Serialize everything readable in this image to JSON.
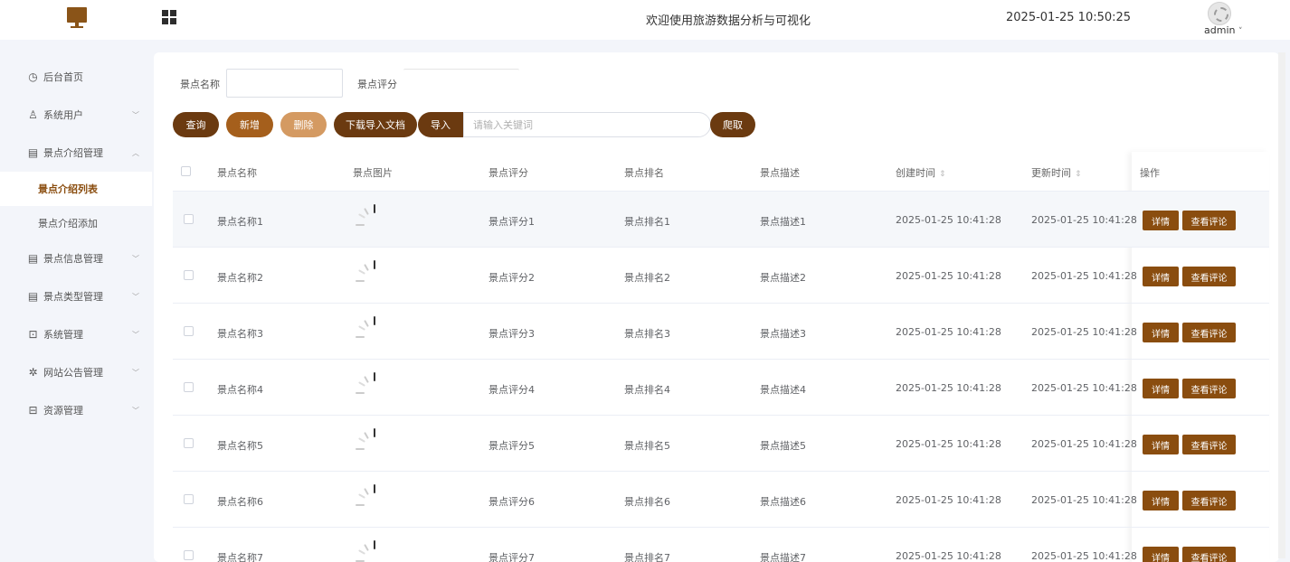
{
  "header": {
    "title": "欢迎使用旅游数据分析与可视化",
    "datetime": "2025-01-25 10:50:25",
    "username": "admin",
    "user_chevron": "˅"
  },
  "sidebar": {
    "items": [
      {
        "label": "后台首页",
        "icon": "clock-icon",
        "glyph": "◷"
      },
      {
        "label": "系统用户",
        "icon": "user-icon",
        "glyph": "♙",
        "chevron": "﹀"
      },
      {
        "label": "景点介绍管理",
        "icon": "doc-icon",
        "glyph": "▤",
        "chevron": "︿"
      },
      {
        "label": "景点信息管理",
        "icon": "doc-icon",
        "glyph": "▤",
        "chevron": "﹀"
      },
      {
        "label": "景点类型管理",
        "icon": "doc-icon",
        "glyph": "▤",
        "chevron": "﹀"
      },
      {
        "label": "系统管理",
        "icon": "folder-icon",
        "glyph": "⊡",
        "chevron": "﹀"
      },
      {
        "label": "网站公告管理",
        "icon": "sparkle-icon",
        "glyph": "✲",
        "chevron": "﹀"
      },
      {
        "label": "资源管理",
        "icon": "monitor-icon",
        "glyph": "⊟",
        "chevron": "﹀"
      }
    ],
    "subitems": [
      {
        "label": "景点介绍列表",
        "active": true
      },
      {
        "label": "景点介绍添加",
        "active": false
      }
    ]
  },
  "search": {
    "name_label": "景点名称",
    "name_value": "",
    "score_label": "景点评分",
    "score_value": ""
  },
  "toolbar": {
    "query": "查询",
    "add": "新增",
    "delete": "删除",
    "download_template": "下载导入文档",
    "import": "导入",
    "keyword_placeholder": "请输入关键词",
    "crawl": "爬取"
  },
  "table": {
    "columns": [
      "景点名称",
      "景点图片",
      "景点评分",
      "景点排名",
      "景点描述",
      "创建时间",
      "更新时间",
      "操作"
    ],
    "sort_glyph": "⇕",
    "detail_label": "详情",
    "comments_label": "查看评论",
    "rows": [
      {
        "name": "景点名称1",
        "score": "景点评分1",
        "rank": "景点排名1",
        "desc": "景点描述1",
        "created": "2025-01-25 10:41:28",
        "updated": "2025-01-25 10:41:28"
      },
      {
        "name": "景点名称2",
        "score": "景点评分2",
        "rank": "景点排名2",
        "desc": "景点描述2",
        "created": "2025-01-25 10:41:28",
        "updated": "2025-01-25 10:41:28"
      },
      {
        "name": "景点名称3",
        "score": "景点评分3",
        "rank": "景点排名3",
        "desc": "景点描述3",
        "created": "2025-01-25 10:41:28",
        "updated": "2025-01-25 10:41:28"
      },
      {
        "name": "景点名称4",
        "score": "景点评分4",
        "rank": "景点排名4",
        "desc": "景点描述4",
        "created": "2025-01-25 10:41:28",
        "updated": "2025-01-25 10:41:28"
      },
      {
        "name": "景点名称5",
        "score": "景点评分5",
        "rank": "景点排名5",
        "desc": "景点描述5",
        "created": "2025-01-25 10:41:28",
        "updated": "2025-01-25 10:41:28"
      },
      {
        "name": "景点名称6",
        "score": "景点评分6",
        "rank": "景点排名6",
        "desc": "景点描述6",
        "created": "2025-01-25 10:41:28",
        "updated": "2025-01-25 10:41:28"
      },
      {
        "name": "景点名称7",
        "score": "景点评分7",
        "rank": "景点排名7",
        "desc": "景点描述7",
        "created": "2025-01-25 10:41:28",
        "updated": "2025-01-25 10:41:28"
      }
    ]
  },
  "colors": {
    "brand": "#8a4d0f",
    "dark_button": "#6b3a10",
    "mid_button": "#a55f1c",
    "light_button": "#d49a62"
  }
}
